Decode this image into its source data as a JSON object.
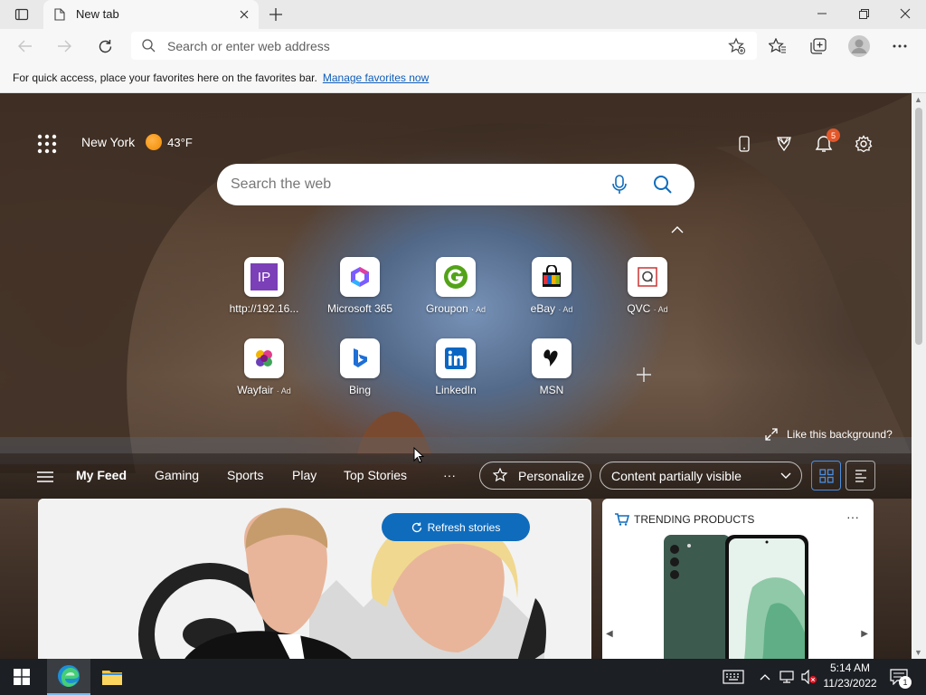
{
  "browser": {
    "tab_title": "New tab",
    "address_placeholder": "Search or enter web address"
  },
  "favorites_bar": {
    "message": "For quick access, place your favorites here on the favorites bar.",
    "link": "Manage favorites now"
  },
  "header": {
    "city": "New York",
    "temperature": "43°F",
    "notification_count": "5"
  },
  "search": {
    "placeholder": "Search the web"
  },
  "quick_links": [
    {
      "label": "http://192.16...",
      "ad": "",
      "icon": "ip-icon",
      "color": "#7b3fb8"
    },
    {
      "label": "Microsoft 365",
      "ad": "",
      "icon": "microsoft-365-icon",
      "color": "#7a5cff"
    },
    {
      "label": "Groupon",
      "ad": "· Ad",
      "icon": "groupon-icon",
      "color": "#53a318"
    },
    {
      "label": "eBay",
      "ad": "· Ad",
      "icon": "ebay-icon",
      "color": "#e53238"
    },
    {
      "label": "QVC",
      "ad": "· Ad",
      "icon": "qvc-icon",
      "color": "#b33"
    },
    {
      "label": "Wayfair",
      "ad": "· Ad",
      "icon": "wayfair-icon",
      "color": "#7f187f"
    },
    {
      "label": "Bing",
      "ad": "",
      "icon": "bing-icon",
      "color": "#1f6fd6"
    },
    {
      "label": "LinkedIn",
      "ad": "",
      "icon": "linkedin-icon",
      "color": "#0a66c2"
    },
    {
      "label": "MSN",
      "ad": "",
      "icon": "msn-icon",
      "color": "#111"
    }
  ],
  "like_background": "Like this background?",
  "feed_nav": {
    "items": [
      "My Feed",
      "Gaming",
      "Sports",
      "Play",
      "Top Stories"
    ],
    "more": "···",
    "personalize": "Personalize",
    "content_visibility": "Content partially visible"
  },
  "main_card": {
    "refresh_label": "Refresh stories"
  },
  "side_card": {
    "title": "TRENDING PRODUCTS",
    "more": "···"
  },
  "taskbar": {
    "time": "5:14 AM",
    "date": "11/23/2022",
    "notification_count": "1"
  },
  "colors": {
    "accent": "#0f6cbd",
    "badge": "#e2572a"
  }
}
